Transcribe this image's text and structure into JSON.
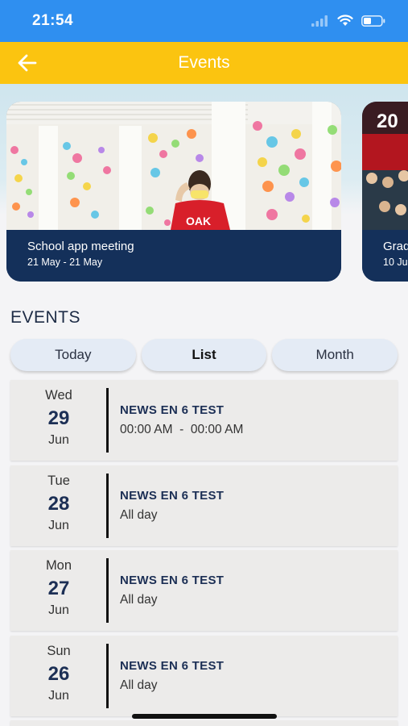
{
  "status_bar": {
    "time": "21:54"
  },
  "header": {
    "title": "Events"
  },
  "featured": [
    {
      "title": "School app meeting",
      "dates": "21 May  -  21 May"
    },
    {
      "title": "Grad",
      "dates": "10 Ju",
      "badge": "20"
    }
  ],
  "section_title": "EVENTS",
  "tabs": [
    {
      "label": "Today"
    },
    {
      "label": "List"
    },
    {
      "label": "Month"
    }
  ],
  "events": [
    {
      "weekday": "Wed",
      "day": "29",
      "month": "Jun",
      "title": "NEWS EN 6 TEST",
      "time": "00:00 AM  -  00:00 AM"
    },
    {
      "weekday": "Tue",
      "day": "28",
      "month": "Jun",
      "title": "NEWS EN 6 TEST",
      "time": "All day"
    },
    {
      "weekday": "Mon",
      "day": "27",
      "month": "Jun",
      "title": "NEWS EN 6 TEST",
      "time": "All day"
    },
    {
      "weekday": "Sun",
      "day": "26",
      "month": "Jun",
      "title": "NEWS EN 6 TEST",
      "time": "All day"
    }
  ],
  "colors": {
    "status_bar": "#2f8ff0",
    "header": "#fbc410",
    "card_footer": "#14305a",
    "tab_bg": "#e4ebf5"
  },
  "photo_text": "OAK"
}
